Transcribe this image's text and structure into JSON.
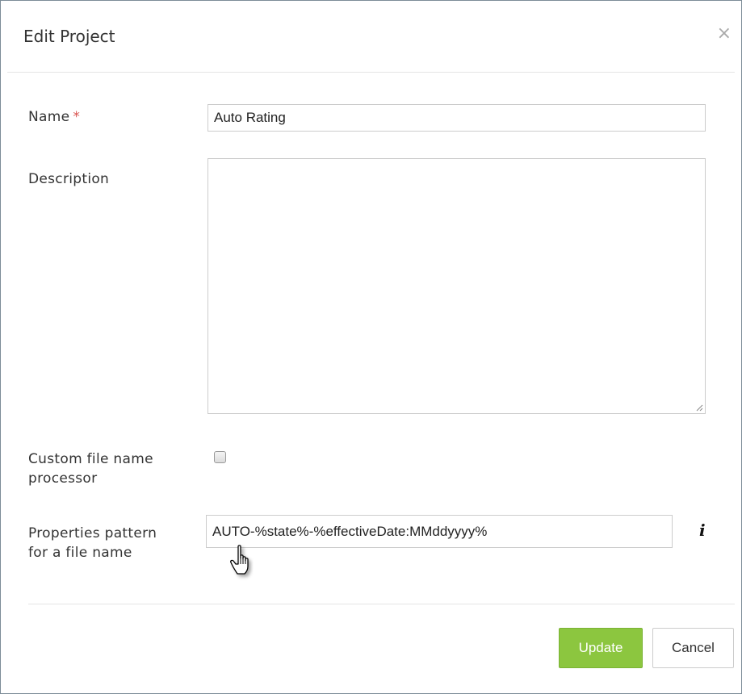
{
  "dialog": {
    "title": "Edit Project",
    "close_symbol": "×"
  },
  "form": {
    "name_label": "Name",
    "required_marker": "*",
    "name_value": "Auto Rating",
    "description_label": "Description",
    "description_value": "",
    "custom_processor_label_line1": "Custom file name",
    "custom_processor_label_line2": "processor",
    "custom_processor_checked": false,
    "pattern_label_line1": "Properties pattern",
    "pattern_label_line2": "for a file name",
    "pattern_value": "AUTO-%state%-%effectiveDate:MMddyyyy%",
    "info_symbol": "i"
  },
  "footer": {
    "update_label": "Update",
    "cancel_label": "Cancel"
  },
  "colors": {
    "primary_button": "#8cc63f",
    "required_marker": "#d9534f"
  },
  "icons": {
    "close": "close-icon",
    "info": "info-icon",
    "cursor": "hand-pointer-icon",
    "resize": "resize-grip-icon"
  }
}
